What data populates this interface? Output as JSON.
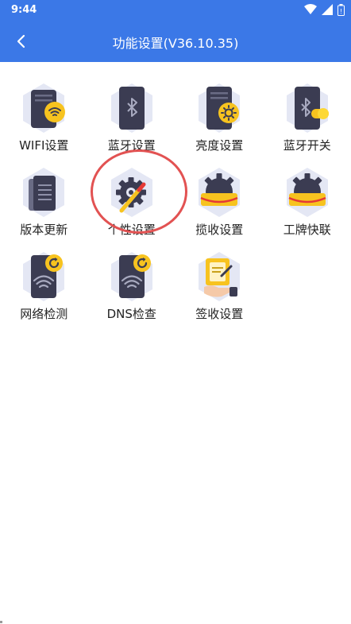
{
  "status_bar": {
    "time": "9:44",
    "icons": [
      "wifi-icon",
      "signal-icon",
      "battery-icon"
    ]
  },
  "header": {
    "title": "功能设置(V36.10.35)",
    "back_icon": "chevron-left-icon"
  },
  "colors": {
    "accent": "#3b78e7",
    "highlight": "#e25252",
    "tile_bg": "#e4e7f4",
    "device": "#3b3c52",
    "badge": "#f7c31f"
  },
  "menu_items": [
    {
      "label": "WIFI设置",
      "icon": "wifi-settings-icon"
    },
    {
      "label": "蓝牙设置",
      "icon": "bluetooth-settings-icon"
    },
    {
      "label": "亮度设置",
      "icon": "brightness-settings-icon"
    },
    {
      "label": "蓝牙开关",
      "icon": "bluetooth-toggle-icon"
    },
    {
      "label": "版本更新",
      "icon": "version-update-icon"
    },
    {
      "label": "个性设置",
      "icon": "personal-settings-icon"
    },
    {
      "label": "揽收设置",
      "icon": "pickup-settings-icon"
    },
    {
      "label": "工牌快联",
      "icon": "badge-quick-connect-icon"
    },
    {
      "label": "网络检测",
      "icon": "network-check-icon"
    },
    {
      "label": "DNS检查",
      "icon": "dns-check-icon"
    },
    {
      "label": "签收设置",
      "icon": "signoff-settings-icon"
    }
  ]
}
